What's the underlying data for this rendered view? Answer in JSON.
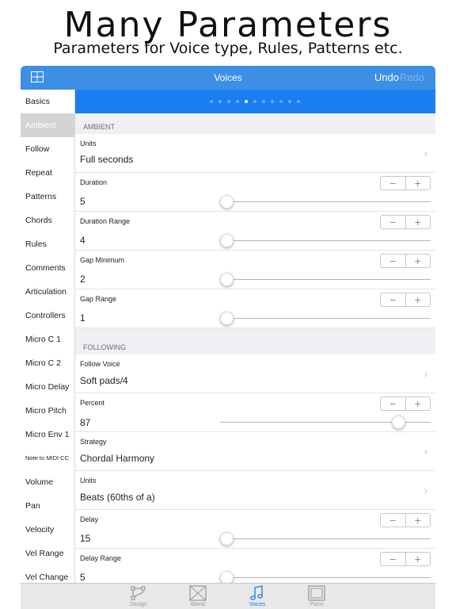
{
  "promo": {
    "title": "Many Parameters",
    "subtitle": "Parameters for Voice type, Rules, Patterns etc."
  },
  "navbar": {
    "title": "Voices",
    "undo_label": "Undo",
    "redo_label": "Redo",
    "menu_icon": "grid-icon"
  },
  "colors": {
    "accent": "#3d8fe6",
    "pager": "#1a7ef0",
    "sidebar_active": "#d4d4d4"
  },
  "sidebar": {
    "active_index": 1,
    "items": [
      {
        "label": "Basics"
      },
      {
        "label": "Ambient"
      },
      {
        "label": "Follow"
      },
      {
        "label": "Repeat"
      },
      {
        "label": "Patterns"
      },
      {
        "label": "Chords"
      },
      {
        "label": "Rules"
      },
      {
        "label": "Comments"
      },
      {
        "label": "Articulation"
      },
      {
        "label": "Controllers"
      },
      {
        "label": "Micro C 1"
      },
      {
        "label": "Micro C 2"
      },
      {
        "label": "Micro Delay"
      },
      {
        "label": "Micro Pitch"
      },
      {
        "label": "Micro Env 1"
      },
      {
        "label": "Note to MIDI CC"
      },
      {
        "label": "Volume"
      },
      {
        "label": "Pan"
      },
      {
        "label": "Velocity"
      },
      {
        "label": "Vel Range"
      },
      {
        "label": "Vel Change"
      }
    ]
  },
  "pager": {
    "page_count": 11,
    "current_page": 5
  },
  "sections": {
    "ambient": {
      "header": "AMBIENT",
      "units": {
        "label": "Units",
        "value": "Full seconds"
      },
      "duration": {
        "label": "Duration",
        "value": "5",
        "slider_fraction": 0.0
      },
      "duration_range": {
        "label": "Duration Range",
        "value": "4",
        "slider_fraction": 0.0
      },
      "gap_minimum": {
        "label": "Gap Minimum",
        "value": "2",
        "slider_fraction": 0.0
      },
      "gap_range": {
        "label": "Gap Range",
        "value": "1",
        "slider_fraction": 0.0
      }
    },
    "following": {
      "header": "FOLLOWING",
      "follow_voice": {
        "label": "Follow Voice",
        "value": "Soft pads/4"
      },
      "percent": {
        "label": "Percent",
        "value": "87",
        "slider_fraction": 0.87
      },
      "strategy": {
        "label": "Strategy",
        "value": "Chordal Harmony"
      },
      "units": {
        "label": "Units",
        "value": "Beats (60ths of a)"
      },
      "delay": {
        "label": "Delay",
        "value": "15",
        "slider_fraction": 0.0
      },
      "delay_range": {
        "label": "Delay Range",
        "value": "5",
        "slider_fraction": 0.0
      }
    }
  },
  "stepper": {
    "minus": "−",
    "plus": "+"
  },
  "chevron": "›",
  "tabbar": {
    "active_index": 2,
    "tabs": [
      {
        "label": "Design",
        "icon": "design-icon"
      },
      {
        "label": "Blend",
        "icon": "blend-icon"
      },
      {
        "label": "Voices",
        "icon": "voices-icon"
      },
      {
        "label": "Piece",
        "icon": "piece-icon"
      }
    ]
  }
}
